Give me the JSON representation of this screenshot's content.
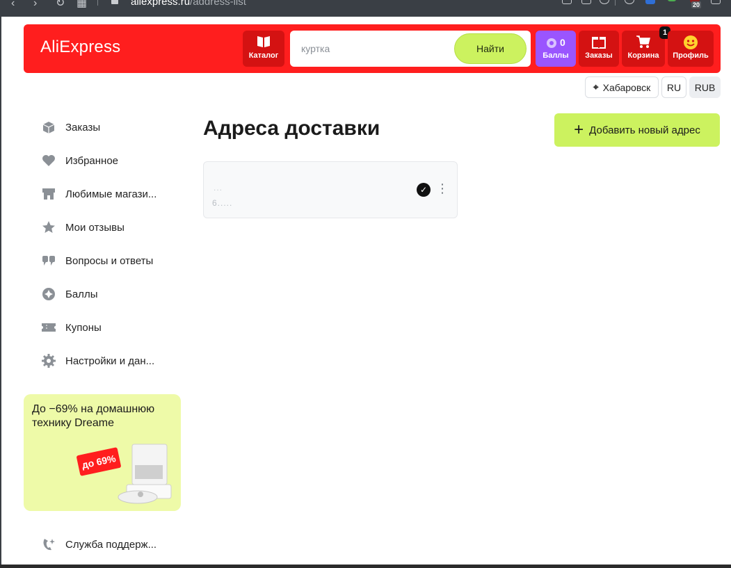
{
  "browser": {
    "url_host": "aliexpress.ru",
    "url_path": "/address-list",
    "extension_badge": "20"
  },
  "header": {
    "logo": "AliExpress",
    "catalog_label": "Каталог",
    "search_placeholder": "куртка",
    "search_button": "Найти",
    "bonus_count": "0",
    "bonus_label": "Баллы",
    "orders_label": "Заказы",
    "cart_label": "Корзина",
    "cart_badge": "1",
    "profile_label": "Профиль",
    "colors": {
      "brand": "#ff1e1e",
      "accent": "#ccf25f",
      "bonus": "#9a55ff"
    }
  },
  "region": {
    "city": "Хабаровск",
    "language": "RU",
    "currency": "RUB"
  },
  "sidebar": {
    "items": [
      {
        "label": "Заказы",
        "icon": "box-icon"
      },
      {
        "label": "Избранное",
        "icon": "heart-icon"
      },
      {
        "label": "Любимые магази...",
        "icon": "store-icon"
      },
      {
        "label": "Мои отзывы",
        "icon": "star-icon"
      },
      {
        "label": "Вопросы и ответы",
        "icon": "quotes-icon"
      },
      {
        "label": "Баллы",
        "icon": "points-icon"
      },
      {
        "label": "Купоны",
        "icon": "coupon-icon"
      },
      {
        "label": "Настройки и дан...",
        "icon": "gear-icon"
      }
    ],
    "support_label": "Служба поддерж...",
    "promo": {
      "text": "До −69% на домашнюю технику Dreame",
      "tag": "до 69%"
    }
  },
  "main": {
    "title": "Адреса доставки",
    "add_button": "Добавить новый адрес",
    "address_card": {
      "line1": "...",
      "line2": "6....."
    }
  }
}
